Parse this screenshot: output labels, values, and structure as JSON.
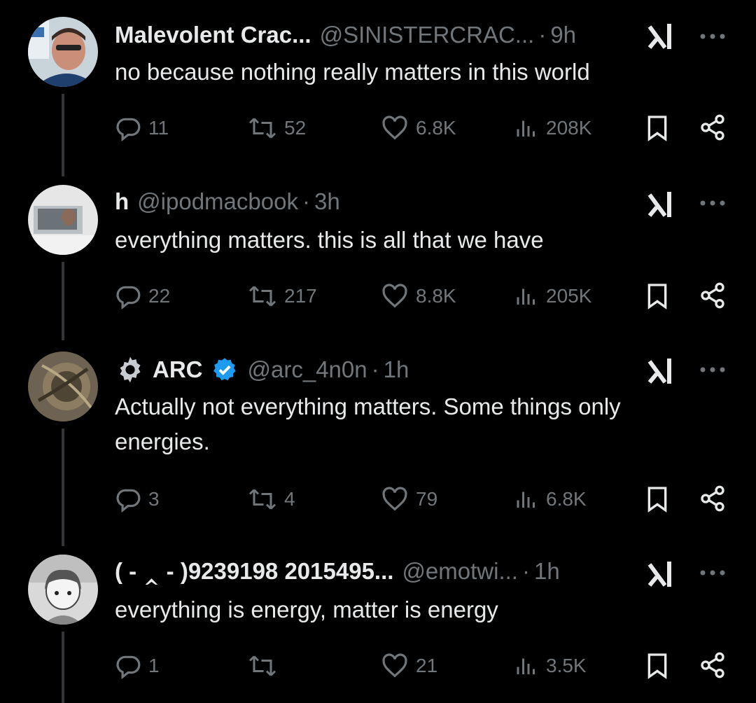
{
  "tweets": [
    {
      "name": "Malevolent Crac...",
      "handle": "@SINISTERCRAC...",
      "dot": "·",
      "time": "9h",
      "text": "no because nothing really matters in this world",
      "replies": "11",
      "reposts": "52",
      "likes": "6.8K",
      "views": "208K"
    },
    {
      "name": "h",
      "handle": "@ipodmacbook",
      "dot": "·",
      "time": "3h",
      "text": "everything matters. this is all that we have",
      "replies": "22",
      "reposts": "217",
      "likes": "8.8K",
      "views": "205K"
    },
    {
      "name": "ARC",
      "handle": "@arc_4n0n",
      "dot": "·",
      "time": "1h",
      "text": "Actually not everything matters. Some things only energies.",
      "replies": "3",
      "reposts": "4",
      "likes": "79",
      "views": "6.8K"
    },
    {
      "name": "( - ‸ - )9239198 2015495...",
      "handle": "@emotwi...",
      "dot": "·",
      "time": "1h",
      "text": "everything is energy, matter is energy",
      "replies": "1",
      "reposts": "",
      "likes": "21",
      "views": "3.5K"
    }
  ],
  "colors": {
    "background": "#000000",
    "primary_text": "#e7e9ea",
    "secondary_text": "#71767b",
    "thread_line": "#333639",
    "verified_badge": "#1d9bf0"
  }
}
